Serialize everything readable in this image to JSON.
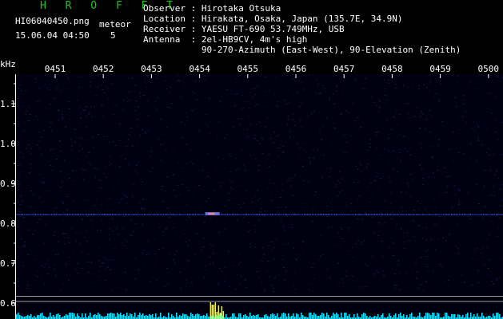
{
  "header": {
    "title": "H R O F F T",
    "filename": "HI06040450.png",
    "datetime": "15.06.04 04:50",
    "meteor_label": "meteor",
    "meteor_count": "5",
    "observer_label": "Observer",
    "observer": "Hirotaka Otsuka",
    "location_label": "Location",
    "location": "Hirakata, Osaka, Japan (135.7E, 34.9N)",
    "receiver_label": "Receiver",
    "receiver": "YAESU FT-690 53.749MHz, USB",
    "antenna_label": "Antenna",
    "antenna": "2el-HB9CV, 4m's high",
    "antenna_detail": "90-270-Azimuth (East-West), 90-Elevation (Zenith)"
  },
  "chart_data": {
    "type": "heatmap",
    "ylabel": "kHz",
    "x_ticks": [
      "0451",
      "0452",
      "0453",
      "0454",
      "0455",
      "0456",
      "0457",
      "0458",
      "0459",
      "0500"
    ],
    "y_ticks": [
      "1.1",
      "1.0",
      "0.9",
      "0.8",
      "0.7",
      "0.6"
    ],
    "y_tick_values": [
      1.1,
      1.0,
      0.9,
      0.8,
      0.7,
      0.6
    ],
    "ylim": [
      0.58,
      1.2
    ],
    "noise_band_khz": 0.822,
    "meteor_echo": {
      "time": "0454",
      "freq_khz": 0.824
    },
    "reference_lines_khz": [
      0.617,
      0.604
    ],
    "colors": {
      "background": "#000010",
      "label": "#ffffff",
      "accent": "#19c719",
      "echo": "#ffff00",
      "spectrum": "#00e5ff"
    }
  }
}
